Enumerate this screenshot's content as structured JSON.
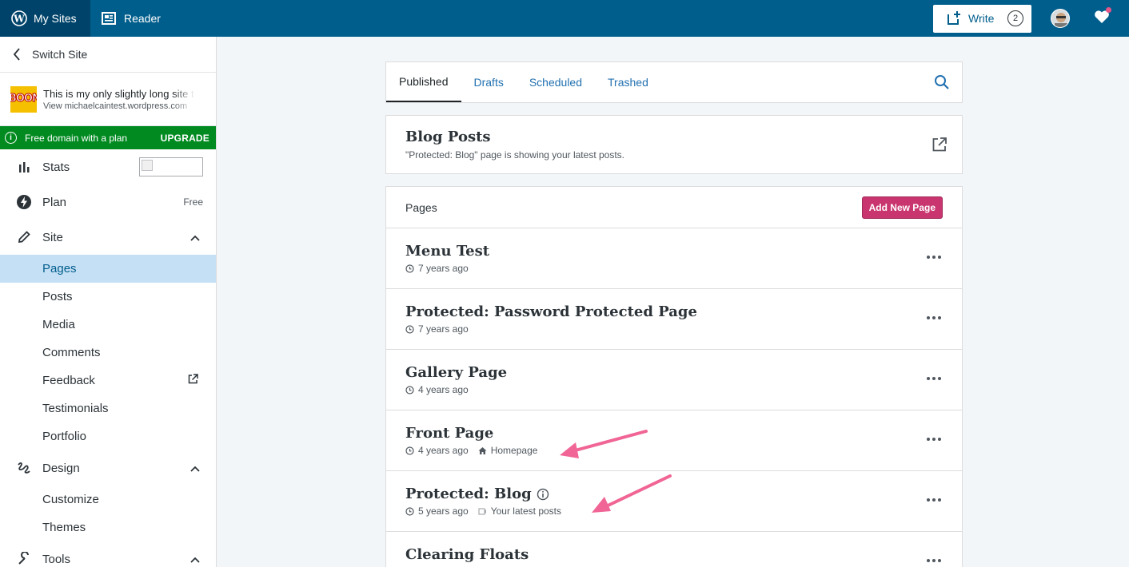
{
  "masterbar": {
    "my_sites": "My Sites",
    "reader": "Reader",
    "write": "Write",
    "write_count": "2"
  },
  "sidebar": {
    "switch_site": "Switch Site",
    "site_icon_text": "BOOM",
    "site_title": "This is my only slightly long site title",
    "site_url": "View michaelcaintest.wordpress.com",
    "upsell_text": "Free domain with a plan",
    "upsell_cta": "UPGRADE",
    "stats": "Stats",
    "plan": "Plan",
    "plan_tag": "Free",
    "site": "Site",
    "site_items": [
      "Pages",
      "Posts",
      "Media",
      "Comments",
      "Feedback",
      "Testimonials",
      "Portfolio"
    ],
    "design": "Design",
    "design_items": [
      "Customize",
      "Themes"
    ],
    "tools": "Tools"
  },
  "tabs": {
    "published": "Published",
    "drafts": "Drafts",
    "scheduled": "Scheduled",
    "trashed": "Trashed"
  },
  "blog_posts": {
    "title": "Blog Posts",
    "subtitle": "\"Protected: Blog\" page is showing your latest posts."
  },
  "pages": {
    "header": "Pages",
    "add_new": "Add New Page",
    "rows": [
      {
        "title": "Menu Test",
        "time": "7 years ago",
        "badge": ""
      },
      {
        "title": "Protected: Password Protected Page",
        "time": "7 years ago",
        "badge": ""
      },
      {
        "title": "Gallery Page",
        "time": "4 years ago",
        "badge": ""
      },
      {
        "title": "Front Page",
        "time": "4 years ago",
        "badge": "Homepage"
      },
      {
        "title": "Protected: Blog",
        "time": "5 years ago",
        "badge": "Your latest posts"
      },
      {
        "title": "Clearing Floats",
        "time": "",
        "badge": ""
      }
    ]
  },
  "colors": {
    "masterbar": "#005e8c",
    "upsell": "#008a20",
    "add_page": "#c9356e",
    "selected": "#c5dff5",
    "arrow": "#f06595"
  }
}
